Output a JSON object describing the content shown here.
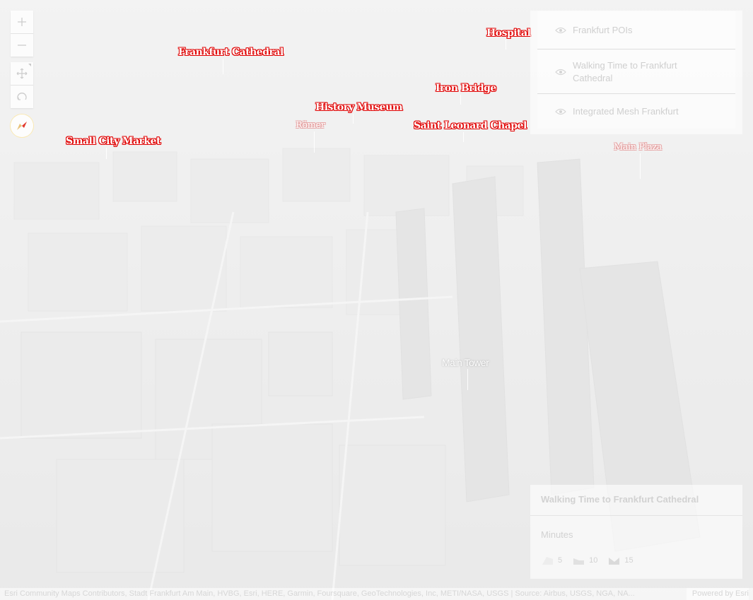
{
  "map": {
    "labels": [
      {
        "id": "hospital",
        "text": "Hospital",
        "style": "red"
      },
      {
        "id": "frankfurt-cathedral",
        "text": "Frankfurt Cathedral",
        "style": "red"
      },
      {
        "id": "iron-bridge",
        "text": "Iron Bridge",
        "style": "red"
      },
      {
        "id": "history-museum",
        "text": "History Museum",
        "style": "red"
      },
      {
        "id": "romer",
        "text": "Römer",
        "style": "pale"
      },
      {
        "id": "saint-leonard-chapel",
        "text": "Saint Leonard Chapel",
        "style": "red"
      },
      {
        "id": "small-city-market",
        "text": "Small City Market",
        "style": "red"
      },
      {
        "id": "main-plaza",
        "text": "Main Plaza",
        "style": "pale"
      },
      {
        "id": "main-tower",
        "text": "Main Tower",
        "style": "white"
      }
    ],
    "accent_color": "#e00000"
  },
  "nav": {
    "zoom_in_icon": "plus-icon",
    "zoom_out_icon": "minus-icon",
    "pan_icon": "pan-arrows-icon",
    "rotate_icon": "rotate-icon",
    "compass_icon": "compass-icon"
  },
  "layer_list": {
    "items": [
      {
        "label": "Frankfurt POIs",
        "icon": "eye-icon"
      },
      {
        "label": "Walking Time to Frankfurt Cathedral",
        "icon": "eye-icon"
      },
      {
        "label": "Integrated Mesh Frankfurt",
        "icon": "eye-icon"
      }
    ]
  },
  "legend": {
    "title": "Walking Time to Frankfurt Cathedral",
    "field": "Minutes",
    "classes": [
      "5",
      "10",
      "15"
    ]
  },
  "attribution": {
    "sources": "Esri Community Maps Contributors, Stadt Frankfurt Am Main, HVBG, Esri, HERE, Garmin, Foursquare, GeoTechnologies, Inc, METI/NASA, USGS | Source: Airbus, USGS, NGA, NA...",
    "powered_by": "Powered by Esri"
  }
}
